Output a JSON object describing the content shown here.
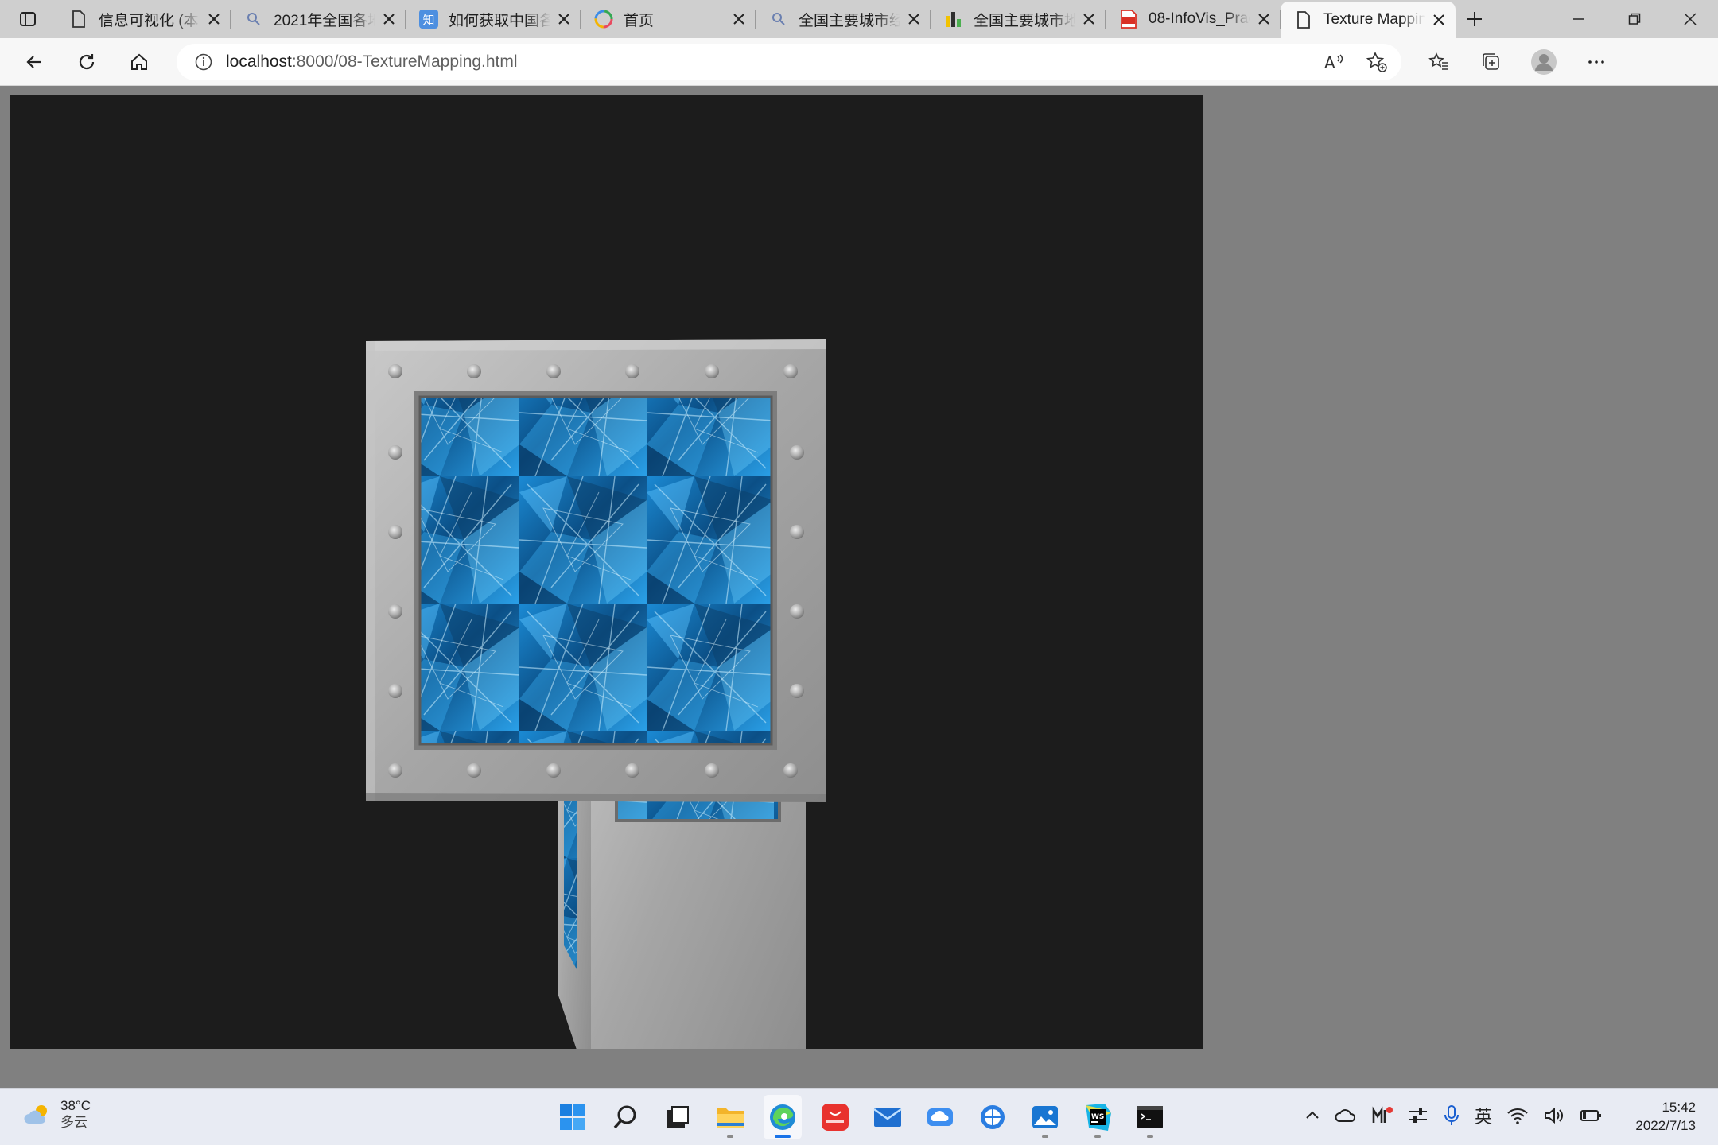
{
  "tabs": [
    {
      "title": "信息可视化 (本⁠",
      "icon": "document-icon",
      "active": false
    },
    {
      "title": "2021年全国各地",
      "icon": "search-icon",
      "active": false
    },
    {
      "title": "如何获取中国各",
      "icon": "zhihu-icon",
      "active": false
    },
    {
      "title": "首页",
      "icon": "colorful-logo-icon",
      "active": false
    },
    {
      "title": "全国主要城市经",
      "icon": "search-icon",
      "active": false
    },
    {
      "title": "全国主要城市地",
      "icon": "chart-logo-icon",
      "active": false
    },
    {
      "title": "08-InfoVis_Prac",
      "icon": "pdf-icon",
      "active": false
    },
    {
      "title": "Texture Mapping",
      "icon": "document-icon",
      "active": true
    }
  ],
  "address": {
    "host": "localhost",
    "path": ":8000/08-TextureMapping.html"
  },
  "colors": {
    "canvas_bg": "#1c1c1c",
    "page_bg": "#808080",
    "crate_metal": "#a9a9a9",
    "crystal_blue": "#1b8ad4"
  },
  "taskbar": {
    "weather_temp": "38°C",
    "weather_desc": "多云",
    "ime": "英",
    "time": "15:42",
    "date": "2022/7/13",
    "apps": [
      "start-icon",
      "search-icon",
      "task-view-icon",
      "file-explorer-icon",
      "edge-icon",
      "huawei-appgallery-icon",
      "mail-icon",
      "onedrive-icon",
      "browser-icon",
      "photos-icon",
      "webstorm-icon",
      "terminal-icon"
    ]
  }
}
